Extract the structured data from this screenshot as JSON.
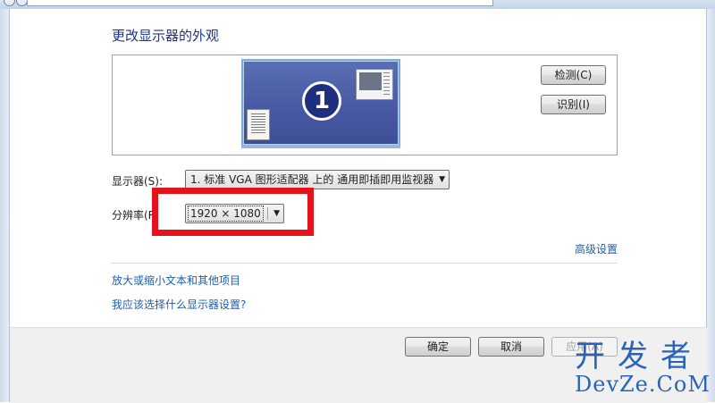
{
  "page": {
    "title": "更改显示器的外观"
  },
  "preview": {
    "monitor_number": "1"
  },
  "buttons": {
    "detect": "检测(C)",
    "identify": "识别(I)",
    "ok": "确定",
    "cancel": "取消",
    "apply": "应用(A)"
  },
  "display": {
    "label": "显示器(S):",
    "value": "1. 标准 VGA 图形适配器 上的 通用即插即用监视器"
  },
  "resolution": {
    "label": "分辨率(R",
    "value": "1920 × 1080"
  },
  "links": {
    "advanced": "高级设置",
    "text_size": "放大或缩小文本和其他项目",
    "which_settings": "我应该选择什么显示器设置?"
  },
  "watermark": {
    "cn": "开发者",
    "en": "DevZe.CoM"
  },
  "colors": {
    "highlight": "#e4121a",
    "link": "#1e5fa8",
    "title": "#1e3287"
  }
}
